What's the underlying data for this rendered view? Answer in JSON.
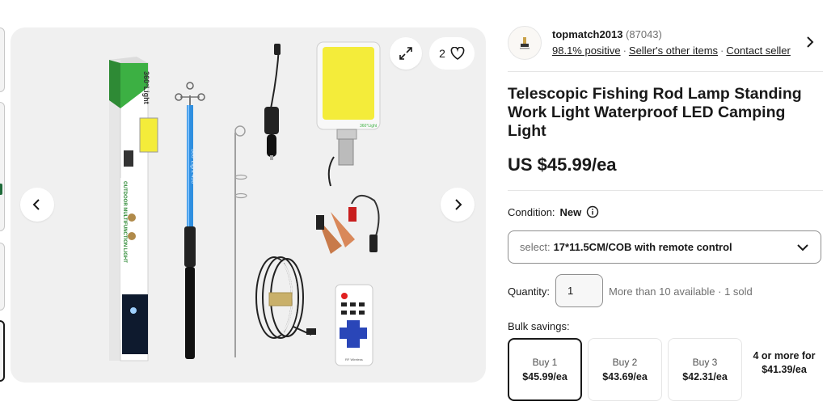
{
  "gallery": {
    "favorite_count": "2",
    "product_box_text": "360°Light",
    "box_side_text": "OUTDOOR MULTIFUNCTION LIGHT",
    "pole_text": "360°Light 450",
    "panel_text": "360°Light",
    "remote_text": "RF Wireless",
    "icons": [
      "expand-icon",
      "heart-icon",
      "chevron-left-icon",
      "chevron-right-icon"
    ]
  },
  "seller": {
    "name": "topmatch2013",
    "feedback_count": "(87043)",
    "positive": "98.1% positive",
    "other_items": "Seller's other items",
    "contact": "Contact seller"
  },
  "listing": {
    "title": "Telescopic Fishing Rod Lamp Standing Work Light Waterproof LED Camping Light",
    "price": "US $45.99/ea",
    "condition_label": "Condition:",
    "condition_value": "New",
    "select_label": "select:",
    "select_value": "17*11.5CM/COB with remote control",
    "quantity_label": "Quantity:",
    "quantity_value": "1",
    "availability": "More than 10 available · 1 sold",
    "bulk_label": "Bulk savings:",
    "tiers": [
      {
        "qty": "Buy 1",
        "price": "$45.99/ea"
      },
      {
        "qty": "Buy 2",
        "price": "$43.69/ea"
      },
      {
        "qty": "Buy 3",
        "price": "$42.31/ea"
      },
      {
        "qty": "4 or more for",
        "price": "$41.39/ea"
      }
    ]
  },
  "colors": {
    "text": "#191919",
    "muted": "#707070",
    "border": "#8f8f8f",
    "pole_blue": "#2f8fe0",
    "led_yellow": "#f4ec3a"
  }
}
